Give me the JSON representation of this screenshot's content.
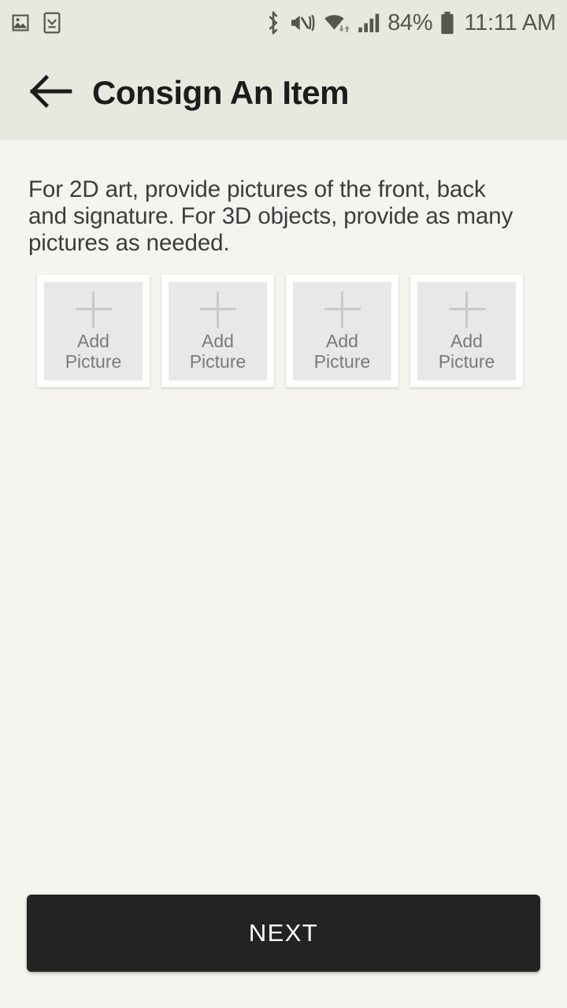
{
  "status_bar": {
    "left_icons": [
      {
        "name": "gallery-image-icon",
        "label": "Gallery"
      },
      {
        "name": "device-checkmark-icon",
        "label": "Device saved"
      }
    ],
    "right_icons": [
      {
        "name": "bluetooth-icon",
        "label": "Bluetooth"
      },
      {
        "name": "mute-vibrate-icon",
        "label": "Sound off / vibrate"
      },
      {
        "name": "wifi-icon",
        "label": "Wi-Fi"
      },
      {
        "name": "cell-signal-icon",
        "label": "Cellular signal"
      }
    ],
    "battery_percent": "84%",
    "battery_icon": "battery-full-icon",
    "time": "11:11 AM"
  },
  "app_bar": {
    "back_icon": "arrow-left-icon",
    "title": "Consign An Item"
  },
  "main": {
    "instructions": "For 2D art, provide pictures of the front, back and signature. For 3D objects, provide as many pictures as needed.",
    "picture_slots": [
      {
        "label": "Add Picture",
        "icon": "plus-icon"
      },
      {
        "label": "Add Picture",
        "icon": "plus-icon"
      },
      {
        "label": "Add Picture",
        "icon": "plus-icon"
      },
      {
        "label": "Add Picture",
        "icon": "plus-icon"
      }
    ]
  },
  "footer": {
    "next_label": "NEXT"
  },
  "colors": {
    "status_bar_bg": "#e9e8de",
    "app_bar_bg": "#e9e8de",
    "page_bg": "#f5f4ef",
    "slot_frame": "#ffffff",
    "slot_inner": "#e8e8e8",
    "plus": "#c9c9c9",
    "primary_button": "#232323",
    "title_text": "#1c1c1c",
    "body_text": "#3c3c3c",
    "status_text": "#55564c"
  }
}
